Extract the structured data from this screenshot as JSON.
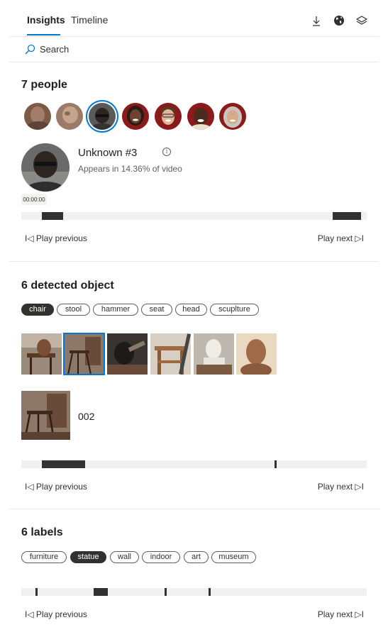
{
  "tabs": {
    "insights": "Insights",
    "timeline": "Timeline"
  },
  "header_icons": [
    "download-icon",
    "globe-icon",
    "layers-icon"
  ],
  "search": {
    "placeholder": "Search"
  },
  "people": {
    "title": "7 people",
    "avatars": [
      "person-1",
      "person-2",
      "person-3",
      "person-4",
      "person-5",
      "person-6",
      "person-7"
    ],
    "selected_index": 2,
    "selected": {
      "name": "Unknown #3",
      "appears": "Appears in 14.36% of video",
      "timestamp": "00:00:00"
    },
    "play_previous": "I◁ Play previous",
    "play_next": "Play next ▷I"
  },
  "objects": {
    "title": "6 detected object",
    "tags": [
      "chair",
      "stool",
      "hammer",
      "seat",
      "head",
      "scuplture"
    ],
    "active_tag": "chair",
    "selected_thumb_index": 1,
    "selected_id": "002",
    "play_previous": "I◁ Play previous",
    "play_next": "Play next ▷I"
  },
  "labels": {
    "title": "6 labels",
    "tags": [
      "furniture",
      "statue",
      "wall",
      "indoor",
      "art",
      "museum"
    ],
    "active_tag": "statue",
    "play_previous": "I◁ Play previous",
    "play_next": "Play next ▷I"
  },
  "colors": {
    "accent": "#0078d4",
    "segment": "#323130",
    "track": "#f0f0f0"
  }
}
